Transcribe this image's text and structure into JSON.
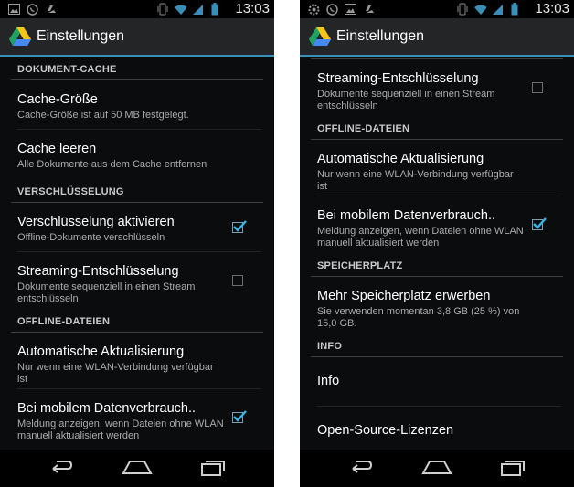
{
  "status_bar": {
    "time": "13:03"
  },
  "app": {
    "title": "Einstellungen"
  },
  "left_screen": {
    "sections": [
      {
        "id": "dokument-cache",
        "header": "DOKUMENT-CACHE",
        "items": [
          {
            "title": "Cache-Größe",
            "summary": "Cache-Größe ist auf 50 MB festgelegt."
          },
          {
            "title": "Cache leeren",
            "summary": "Alle Dokumente aus dem Cache entfernen"
          }
        ]
      },
      {
        "id": "verschluesselung",
        "header": "VERSCHLÜSSELUNG",
        "items": [
          {
            "title": "Verschlüsselung aktivieren",
            "summary": "Offline-Dokumente verschlüsseln",
            "checked": true
          },
          {
            "title": "Streaming-Entschlüsselung",
            "summary": "Dokumente sequenziell in einen Stream entschlüsseln",
            "checked": false
          }
        ]
      },
      {
        "id": "offline-dateien",
        "header": "OFFLINE-DATEIEN",
        "items": [
          {
            "title": "Automatische Aktualisierung",
            "summary": "Nur wenn eine WLAN-Verbindung verfügbar ist"
          },
          {
            "title": "Bei mobilem Datenverbrauch..",
            "summary": "Meldung anzeigen, wenn Dateien ohne WLAN manuell aktualisiert werden",
            "checked": true
          }
        ]
      },
      {
        "id": "speicherplatz",
        "header": "SPEICHERPLATZ",
        "items": []
      }
    ]
  },
  "right_screen": {
    "lead_items": [
      {
        "title": "Streaming-Entschlüsselung",
        "summary": "Dokumente sequenziell in einen Stream entschlüsseln",
        "checked": false
      }
    ],
    "sections": [
      {
        "id": "offline-dateien",
        "header": "OFFLINE-DATEIEN",
        "items": [
          {
            "title": "Automatische Aktualisierung",
            "summary": "Nur wenn eine WLAN-Verbindung verfügbar ist"
          },
          {
            "title": "Bei mobilem Datenverbrauch..",
            "summary": "Meldung anzeigen, wenn Dateien ohne WLAN manuell aktualisiert werden",
            "checked": true
          }
        ]
      },
      {
        "id": "speicherplatz",
        "header": "SPEICHERPLATZ",
        "items": [
          {
            "title": "Mehr Speicherplatz erwerben",
            "summary": "Sie verwenden momentan 3,8 GB (25 %) von 15,0 GB."
          }
        ]
      },
      {
        "id": "info",
        "header": "INFO",
        "items": [
          {
            "title": "Info"
          },
          {
            "title": "Open-Source-Lizenzen"
          }
        ]
      }
    ]
  },
  "icons": {
    "status_left": [
      "gallery-icon",
      "whatsapp-icon",
      "drive-sync-icon"
    ],
    "status_left_right_screen": [
      "settings-icon",
      "whatsapp-icon",
      "gallery-icon",
      "drive-sync-icon"
    ],
    "status_right": [
      "vibrate-icon",
      "wifi-icon",
      "signal-icon",
      "battery-icon"
    ],
    "nav": [
      "back-icon",
      "home-icon",
      "recent-apps-icon"
    ]
  },
  "colors": {
    "accent": "#3a8fb7",
    "background": "#0b0c0e",
    "actionbar": "#232527",
    "checkmark": "#33b5e5"
  }
}
